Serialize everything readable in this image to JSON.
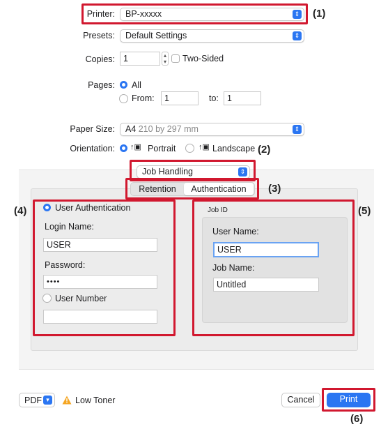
{
  "printer": {
    "label": "Printer:",
    "value": "BP-xxxxx"
  },
  "presets": {
    "label": "Presets:",
    "value": "Default Settings"
  },
  "copies": {
    "label": "Copies:",
    "value": "1",
    "two_sided_label": "Two-Sided"
  },
  "pages": {
    "label": "Pages:",
    "all_label": "All",
    "from_label": "From:",
    "from_value": "1",
    "to_label": "to:",
    "to_value": "1"
  },
  "paper_size": {
    "label": "Paper Size:",
    "value": "A4",
    "dims": "210 by 297 mm"
  },
  "orientation": {
    "label": "Orientation:",
    "portrait": "Portrait",
    "landscape": "Landscape"
  },
  "section_popup": {
    "value": "Job Handling"
  },
  "tabs": [
    {
      "label": "Retention"
    },
    {
      "label": "Authentication"
    }
  ],
  "auth": {
    "user_auth_label": "User Authentication",
    "login_name_label": "Login Name:",
    "login_name_value": "USER",
    "password_label": "Password:",
    "password_value": "••••",
    "user_number_label": "User Number",
    "user_number_value": ""
  },
  "job_id": {
    "title": "Job ID",
    "user_name_label": "User Name:",
    "user_name_value": "USER",
    "job_name_label": "Job Name:",
    "job_name_value": "Untitled"
  },
  "footer": {
    "pdf_label": "PDF",
    "warning_text": "Low Toner",
    "cancel_label": "Cancel",
    "print_label": "Print"
  },
  "callouts": {
    "c1": "(1)",
    "c2": "(2)",
    "c3": "(3)",
    "c4": "(4)",
    "c5": "(5)",
    "c6": "(6)"
  },
  "colors": {
    "accent": "#2b76f2",
    "highlight": "#d1182f",
    "warning": "#f5a623"
  }
}
